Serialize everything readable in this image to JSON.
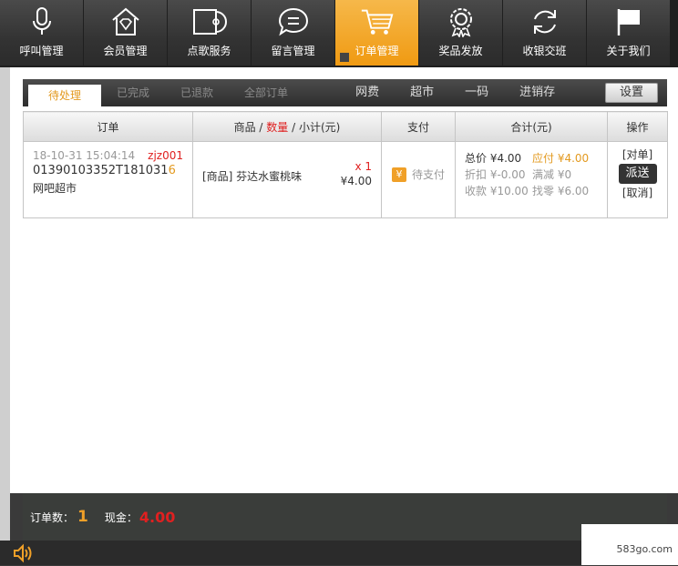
{
  "nav": [
    {
      "label": "呼叫管理",
      "icon": "microphone-icon",
      "active": false
    },
    {
      "label": "会员管理",
      "icon": "diamond-house-icon",
      "active": false
    },
    {
      "label": "点歌服务",
      "icon": "cd-case-icon",
      "active": false
    },
    {
      "label": "留言管理",
      "icon": "chat-bubble-icon",
      "active": false
    },
    {
      "label": "订单管理",
      "icon": "shopping-cart-icon",
      "active": true
    },
    {
      "label": "奖品发放",
      "icon": "award-badge-icon",
      "active": false
    },
    {
      "label": "收银交班",
      "icon": "refresh-icon",
      "active": false
    },
    {
      "label": "关于我们",
      "icon": "flag-icon",
      "active": false
    }
  ],
  "tabs": {
    "pending": "待处理",
    "completed": "已完成",
    "refunded": "已退款",
    "all": "全部订单",
    "netfee": "网费",
    "supermarket": "超市",
    "qr": "一码",
    "inventory": "进销存",
    "settings": "设置"
  },
  "table": {
    "headers": {
      "order": "订单",
      "goods_prefix": "商品 /",
      "goods_qty": "数量",
      "goods_suffix": "/ 小计(元)",
      "payment": "支付",
      "total": "合计(元)",
      "ops": "操作"
    },
    "rows": [
      {
        "time": "18-10-31 15:04:14",
        "operator": "zjz001",
        "order_no_main": "01390103352T181031",
        "order_no_tail": "6",
        "shop": "网吧超市",
        "goods_name": "[商品] 芬达水蜜桃味",
        "qty": "x 1",
        "subtotal": "¥4.00",
        "pay_icon": "¥",
        "pay_status": "待支付",
        "total_price": "总价 ¥4.00",
        "due": "应付 ¥4.00",
        "discount": "折扣 ¥-0.00",
        "reduce": "满减 ¥0",
        "received": "收款 ¥10.00",
        "change": "找零 ¥6.00",
        "op_reconcile": "[对单]",
        "op_dispatch": "派送",
        "op_cancel": "[取消]"
      }
    ]
  },
  "footer": {
    "order_count_label": "订单数：",
    "order_count": "1",
    "cash_label": "现金：",
    "cash": "4.00"
  },
  "watermark": "583go.com",
  "colors": {
    "accent": "#f0a028",
    "alert": "#e02020",
    "nav_bg": "#333333"
  }
}
